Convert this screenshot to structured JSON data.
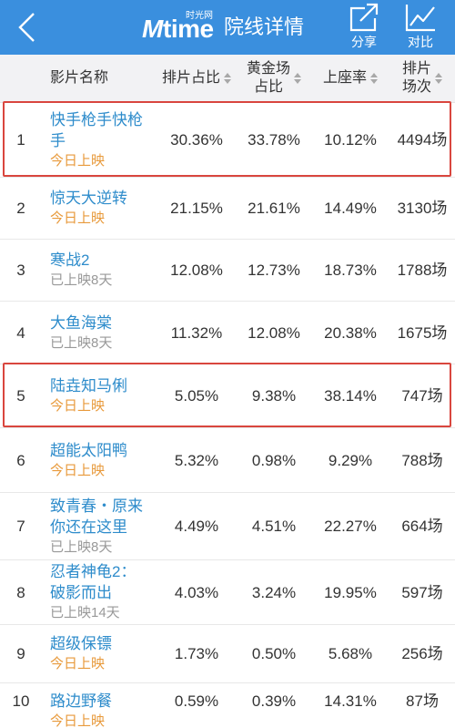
{
  "header": {
    "back_icon": "chevron-left-icon",
    "logo": {
      "mark": "M",
      "word": "time",
      "tagline": "时光网"
    },
    "title": "院线详情",
    "actions": [
      {
        "icon": "share-icon",
        "label": "分享"
      },
      {
        "icon": "line-chart-icon",
        "label": "对比"
      }
    ]
  },
  "table": {
    "columns": {
      "name": "影片名称",
      "schedule_share": "排片占比",
      "golden_share": [
        "黄金场",
        "占比"
      ],
      "occupancy": "上座率",
      "screenings": [
        "排片",
        "场次"
      ],
      "sort_icon": "sort-icon"
    },
    "rows": [
      {
        "rank": "1",
        "title": "快手枪手快枪手",
        "status": "今日上映",
        "status_color": "#e89a3c",
        "schedule_share": "30.36%",
        "golden_share": "33.78%",
        "occupancy": "10.12%",
        "screenings": "4494场",
        "highlighted": true
      },
      {
        "rank": "2",
        "title": "惊天大逆转",
        "status": "今日上映",
        "status_color": "#e89a3c",
        "schedule_share": "21.15%",
        "golden_share": "21.61%",
        "occupancy": "14.49%",
        "screenings": "3130场",
        "highlighted": false
      },
      {
        "rank": "3",
        "title": "寒战2",
        "status": "已上映8天",
        "status_color": "#999999",
        "schedule_share": "12.08%",
        "golden_share": "12.73%",
        "occupancy": "18.73%",
        "screenings": "1788场",
        "highlighted": false
      },
      {
        "rank": "4",
        "title": "大鱼海棠",
        "status": "已上映8天",
        "status_color": "#999999",
        "schedule_share": "11.32%",
        "golden_share": "12.08%",
        "occupancy": "20.38%",
        "screenings": "1675场",
        "highlighted": false
      },
      {
        "rank": "5",
        "title": "陆垚知马俐",
        "status": "今日上映",
        "status_color": "#e89a3c",
        "schedule_share": "5.05%",
        "golden_share": "9.38%",
        "occupancy": "38.14%",
        "screenings": "747场",
        "highlighted": true
      },
      {
        "rank": "6",
        "title": "超能太阳鸭",
        "status": "今日上映",
        "status_color": "#e89a3c",
        "schedule_share": "5.32%",
        "golden_share": "0.98%",
        "occupancy": "9.29%",
        "screenings": "788场",
        "highlighted": false
      },
      {
        "rank": "7",
        "title": "致青春・原来你还在这里",
        "status": "已上映8天",
        "status_color": "#999999",
        "schedule_share": "4.49%",
        "golden_share": "4.51%",
        "occupancy": "22.27%",
        "screenings": "664场",
        "highlighted": false
      },
      {
        "rank": "8",
        "title": "忍者神龟2：破影而出",
        "status": "已上映14天",
        "status_color": "#999999",
        "schedule_share": "4.03%",
        "golden_share": "3.24%",
        "occupancy": "19.95%",
        "screenings": "597场",
        "highlighted": false
      },
      {
        "rank": "9",
        "title": "超级保镖",
        "status": "今日上映",
        "status_color": "#e89a3c",
        "schedule_share": "1.73%",
        "golden_share": "0.50%",
        "occupancy": "5.68%",
        "screenings": "256场",
        "highlighted": false
      },
      {
        "rank": "10",
        "title": "路边野餐",
        "status": "今日上映",
        "status_color": "#e89a3c",
        "schedule_share": "0.59%",
        "golden_share": "0.39%",
        "occupancy": "14.31%",
        "screenings": "87场",
        "highlighted": false
      }
    ]
  },
  "colors": {
    "header_bg": "#3a8fde",
    "header_text": "#ffffff",
    "table_header_bg": "#f2f2f4",
    "movie_title": "#2e8ccb",
    "highlight_border": "#d9463e"
  }
}
